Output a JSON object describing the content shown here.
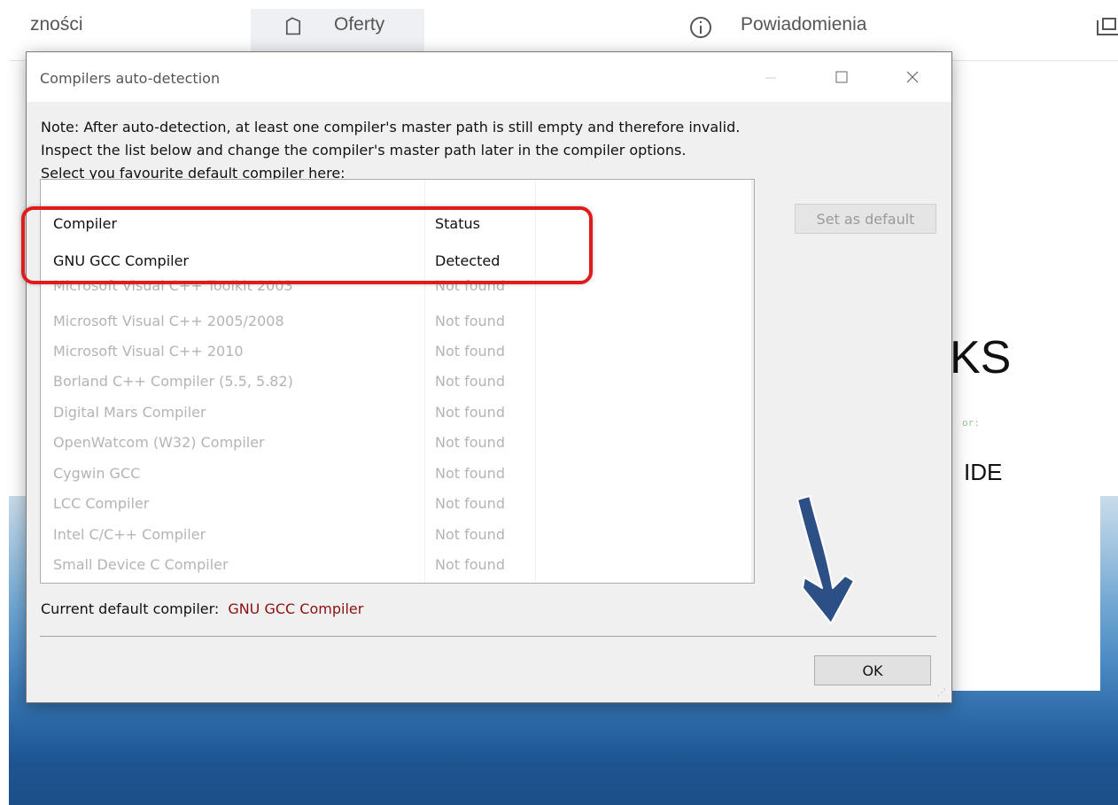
{
  "background": {
    "nav": {
      "item1": "zności",
      "item2": "Oferty",
      "item3": "Powiadomienia"
    },
    "card": {
      "big_text": "KS",
      "small_text": "IDE",
      "tiny_text": "or:"
    }
  },
  "dialog": {
    "title": "Compilers auto-detection",
    "note_lines": [
      "Note: After auto-detection, at least one compiler's master path is still empty and therefore invalid.",
      "Inspect the list below and change the compiler's master path later in the compiler options.",
      "Select you favourite default compiler here:"
    ],
    "columns": {
      "compiler": "Compiler",
      "status": "Status"
    },
    "rows": [
      {
        "compiler": "GNU GCC Compiler",
        "status": "Detected"
      },
      {
        "compiler": "Microsoft Visual C++ Toolkit 2003",
        "status": "Not found"
      },
      {
        "compiler": "Microsoft Visual C++ 2005/2008",
        "status": "Not found"
      },
      {
        "compiler": "Microsoft Visual C++ 2010",
        "status": "Not found"
      },
      {
        "compiler": "Borland C++ Compiler (5.5, 5.82)",
        "status": "Not found"
      },
      {
        "compiler": "Digital Mars Compiler",
        "status": "Not found"
      },
      {
        "compiler": "OpenWatcom (W32) Compiler",
        "status": "Not found"
      },
      {
        "compiler": "Cygwin GCC",
        "status": "Not found"
      },
      {
        "compiler": "LCC Compiler",
        "status": "Not found"
      },
      {
        "compiler": "Intel C/C++ Compiler",
        "status": "Not found"
      },
      {
        "compiler": "Small Device C Compiler",
        "status": "Not found"
      }
    ],
    "set_default_label": "Set as default",
    "current_default_label": "Current default compiler:",
    "current_default_value": "GNU GCC Compiler",
    "ok_label": "OK"
  },
  "colors": {
    "highlight": "#e01b1b",
    "current_value": "#8b1010",
    "arrow": "#2c4f86"
  }
}
